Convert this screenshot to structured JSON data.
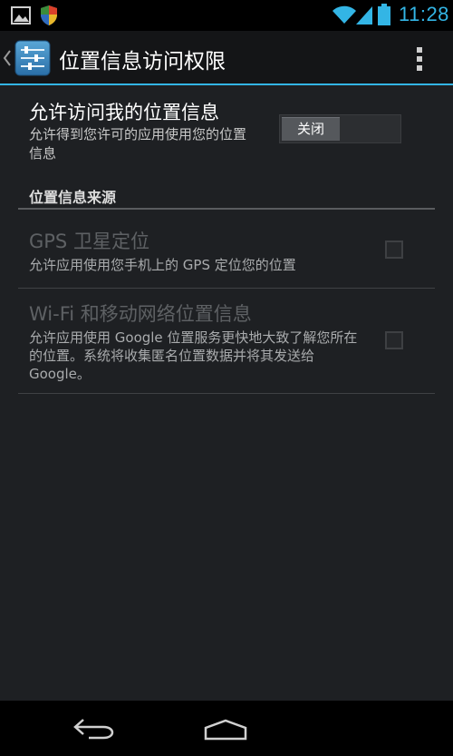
{
  "status_bar": {
    "time": "11:28",
    "icons": [
      "gallery-icon",
      "shield-icon",
      "wifi-icon",
      "cell-signal-icon",
      "battery-icon"
    ],
    "accent_color": "#33b5e5"
  },
  "action_bar": {
    "title": "位置信息访问权限",
    "icons": [
      "back-caret-icon",
      "settings-sliders-icon",
      "overflow-menu-icon"
    ]
  },
  "master_switch": {
    "title": "允许访问我的位置信息",
    "summary": "允许得到您许可的应用使用您的位置信息",
    "switch_label": "关闭"
  },
  "category": {
    "title": "位置信息来源"
  },
  "sources": [
    {
      "title": "GPS 卫星定位",
      "summary": "允许应用使用您手机上的 GPS 定位您的位置"
    },
    {
      "title": "Wi-Fi 和移动网络位置信息",
      "summary": "允许应用使用 Google 位置服务更快地大致了解您所在的位置。系统将收集匿名位置数据并将其发送给 Google。"
    }
  ],
  "nav_bar": {
    "icons": [
      "back-icon",
      "home-icon"
    ]
  }
}
